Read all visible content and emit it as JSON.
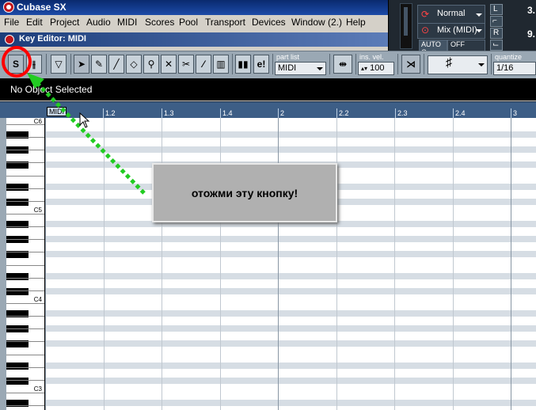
{
  "app": {
    "title": "Cubase SX",
    "menu": [
      "File",
      "Edit",
      "Project",
      "Audio",
      "MIDI",
      "Scores",
      "Pool",
      "Transport",
      "Devices",
      "Window (2.)",
      "Help"
    ]
  },
  "transport": {
    "mode_label": "Normal",
    "mix_label": "Mix (MIDI)",
    "auto_label": "AUTO Q",
    "off_label": "OFF",
    "num_top": "3.",
    "num_bottom": "9."
  },
  "editor": {
    "title": "Key Editor: MIDI",
    "toolbar": {
      "solo_label": "S",
      "part_list_label": "part list",
      "part_list_value": "MIDI",
      "ins_vel_label": "ins. vel.",
      "ins_vel_value": "100",
      "quantize_label": "quantize",
      "quantize_value": "1/16",
      "edit_in_place_label": "e!"
    },
    "info_line": "No Object Selected",
    "ruler": {
      "part_label": "MIDI",
      "marks": [
        "1.2",
        "1.3",
        "1.4",
        "2",
        "2.2",
        "2.3",
        "2.4",
        "3"
      ]
    },
    "keyboard": {
      "labels": [
        "C6",
        "C5",
        "C4",
        "C3"
      ]
    }
  },
  "annotation": {
    "popup_text": "отожми эту кнопку!"
  },
  "colors": {
    "annotation_circle": "#ff0000",
    "annotation_arrow": "#22cc22",
    "ruler_bg": "#3d5e86",
    "toolbar_bg": "#9aa8b4"
  }
}
